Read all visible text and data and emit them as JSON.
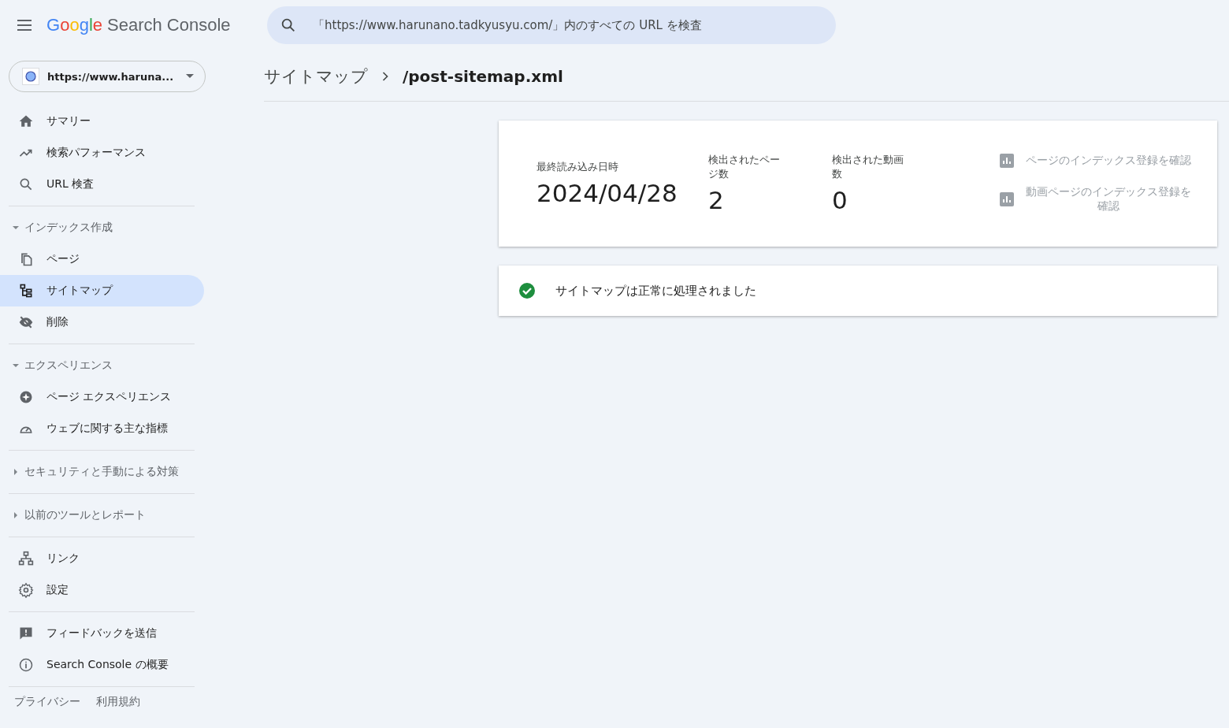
{
  "header": {
    "logo_brand": "Google",
    "logo_product": "Search Console",
    "search": {
      "placeholder": "「https://www.harunano.tadkyusyu.com/」内のすべての URL を検査"
    }
  },
  "property_selector": {
    "value": "https://www.haruna..."
  },
  "sidebar": {
    "sections": [
      {
        "items": [
          {
            "label": "サマリー",
            "selected": false
          },
          {
            "label": "検索パフォーマンス",
            "selected": false
          },
          {
            "label": "URL 検査",
            "selected": false
          }
        ]
      },
      {
        "header": "インデックス作成",
        "expanded": true,
        "items": [
          {
            "label": "ページ",
            "selected": false
          },
          {
            "label": "サイトマップ",
            "selected": true
          },
          {
            "label": "削除",
            "selected": false
          }
        ]
      },
      {
        "header": "エクスペリエンス",
        "expanded": true,
        "items": [
          {
            "label": "ページ エクスペリエンス",
            "selected": false
          },
          {
            "label": "ウェブに関する主な指標",
            "selected": false
          }
        ]
      },
      {
        "header": "セキュリティと手動による対策",
        "expanded": false
      },
      {
        "header": "以前のツールとレポート",
        "expanded": false
      },
      {
        "items": [
          {
            "label": "リンク",
            "selected": false
          },
          {
            "label": "設定",
            "selected": false
          }
        ]
      },
      {
        "items": [
          {
            "label": "フィードバックを送信",
            "selected": false
          },
          {
            "label": "Search Console の概要",
            "selected": false
          }
        ]
      }
    ],
    "footer_links": [
      "プライバシー",
      "利用規約"
    ]
  },
  "breadcrumb": {
    "parent": "サイトマップ",
    "current": "/post-sitemap.xml"
  },
  "summary_card": {
    "stats": [
      {
        "label": "最終読み込み日時",
        "value": "2024/04/28"
      },
      {
        "label": "検出されたページ数",
        "value": "2"
      },
      {
        "label": "検出された動画数",
        "value": "0"
      }
    ],
    "links": [
      {
        "label": "ページのインデックス登録を確認",
        "disabled": true
      },
      {
        "label": "動画ページのインデックス登録を確認",
        "disabled": true
      }
    ]
  },
  "status_card": {
    "message": "サイトマップは正常に処理されました"
  }
}
